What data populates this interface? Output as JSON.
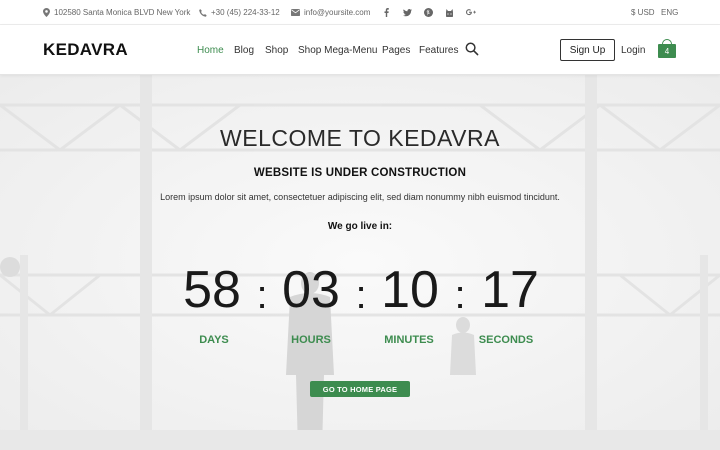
{
  "topbar": {
    "address": "102580 Santa Monica BLVD New York",
    "phone": "+30 (45) 224-33-12",
    "email": "info@yoursite.com",
    "social": [
      "facebook-icon",
      "twitter-icon",
      "pinterest-icon",
      "github-icon",
      "google-plus-icon"
    ],
    "currency": "$ USD",
    "language": "ENG"
  },
  "header": {
    "logo": "KEDAVRA",
    "nav": [
      {
        "label": "Home",
        "active": true
      },
      {
        "label": "Blog"
      },
      {
        "label": "Shop"
      },
      {
        "label": "Shop Mega-Menu"
      },
      {
        "label": "Pages"
      },
      {
        "label": "Features"
      }
    ],
    "signup": "Sign Up",
    "login": "Login",
    "cart_count": "4"
  },
  "hero": {
    "title": "WELCOME TO KEDAVRA",
    "subtitle": "WEBSITE IS UNDER CONSTRUCTION",
    "text": "Lorem ipsum dolor sit amet, consectetuer adipiscing elit, sed diam nonummy nibh euismod tincidunt.",
    "go_live": "We go live in:",
    "countdown": [
      {
        "value": "58",
        "label": "DAYS"
      },
      {
        "value": "03",
        "label": "HOURS"
      },
      {
        "value": "10",
        "label": "MINUTES"
      },
      {
        "value": "17",
        "label": "SECONDS"
      }
    ],
    "separator": ":",
    "button": "GO TO HOME PAGE"
  },
  "colors": {
    "accent": "#3d8c4f"
  }
}
